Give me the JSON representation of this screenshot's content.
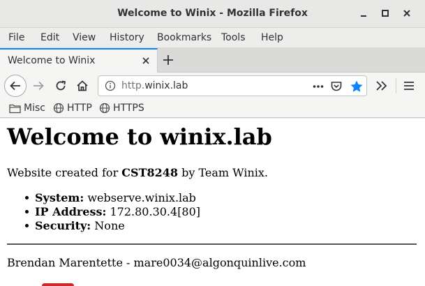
{
  "window": {
    "title": "Welcome to Winix - Mozilla Firefox"
  },
  "menubar": {
    "items": [
      "File",
      "Edit",
      "View",
      "History",
      "Bookmarks",
      "Tools",
      "Help"
    ]
  },
  "tabs": [
    {
      "label": "Welcome to Winix"
    }
  ],
  "urlbar": {
    "scheme": "http.",
    "host": "winix.lab"
  },
  "bookmarks": {
    "items": [
      "Misc",
      "HTTP",
      "HTTPS"
    ]
  },
  "colors": {
    "accent": "#0a84ff",
    "star": "#0a84ff"
  },
  "page": {
    "heading": "Welcome to winix.lab",
    "intro_prefix": "Website created for ",
    "intro_course": "CST8248",
    "intro_suffix": " by Team Winix.",
    "details": [
      {
        "label": "System:",
        "value": " webserve.winix.lab"
      },
      {
        "label": "IP Address:",
        "value": " 172.80.30.4[80]"
      },
      {
        "label": "Security:",
        "value": " None"
      }
    ],
    "footer": "Brendan Marentette - mare0034@algonquinlive.com"
  }
}
